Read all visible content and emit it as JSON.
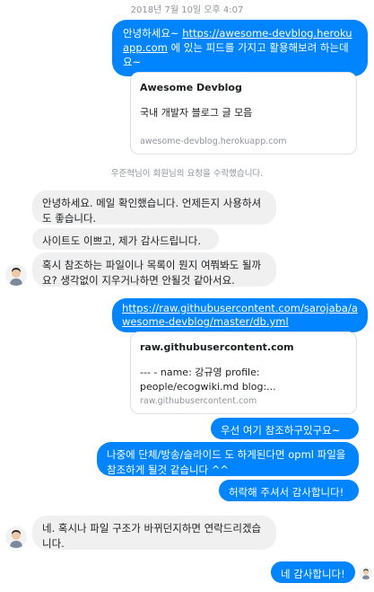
{
  "timestamp": "2018년 7월 10일 오후 4:07",
  "messages": {
    "m1_text": "안녕하세요~ ",
    "m1_link": "https://awesome-devblog.herokuapp.com",
    "m1_rest": " 에 있는 피드를 가지고 활용해보려 하는데요~",
    "card1": {
      "title": "Awesome Devblog",
      "desc": "국내 개발자 블로그 글 모음",
      "domain": "awesome-devblog.herokuapp.com"
    },
    "notice": "우준혁님이 회원님의 요청을 수락했습니다.",
    "in1": "안녕하세요. 메일 확인했습니다. 언제든지 사용하셔도 좋습니다.",
    "in2": "사이트도 이쁘고, 제가 감사드립니다.",
    "in3": "혹시 참조하는 파일이나 목록이 뭔지 여쭤봐도 될까요? 생각없이 지우거나하면 안될것 같아서요.",
    "out_link": "https://raw.githubusercontent.com/sarojaba/awesome-devblog/master/db.yml",
    "card2": {
      "title": "raw.githubusercontent.com",
      "desc": "--- - name: 강규영 profile: people/ecogwiki.md blog:...",
      "domain": "raw.githubusercontent.com"
    },
    "out2": "우선 여기 참조하구있구요~",
    "out3": "나중에 단체/방송/슬라이드 도 하게된다면 opml 파일을 참조하게 될것 같습니다 ^^",
    "out4": "허락해 주셔서 감사합니다!",
    "in4": "네. 혹시나 파일 구조가 바뀌던지하면 연락드리겠습니다.",
    "out5": "네 감사합니다!"
  },
  "colors": {
    "outgoing": "#0084ff",
    "incoming": "#f1f0f0"
  },
  "icons": {
    "avatar": "person-avatar-icon",
    "seen": "seen-avatar-icon"
  }
}
